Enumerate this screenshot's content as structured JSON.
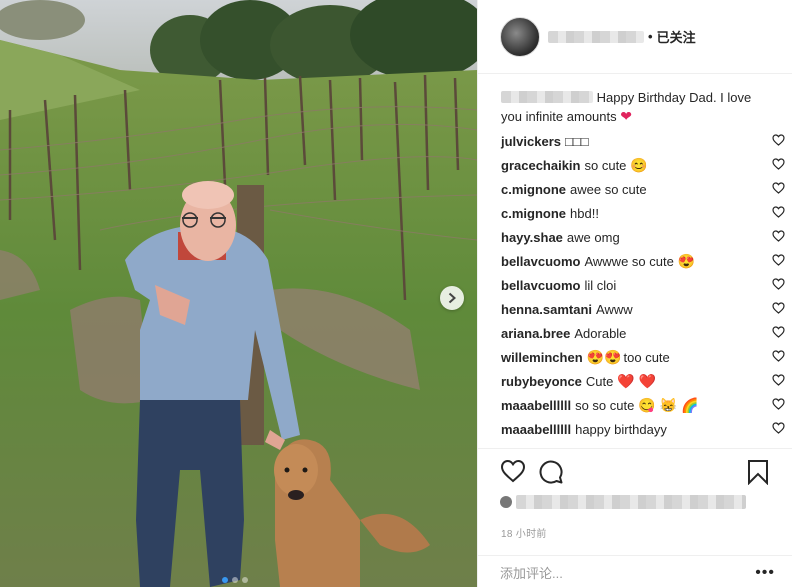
{
  "post": {
    "header": {
      "follow_label": "已关注",
      "dot": "•"
    },
    "caption": {
      "text": " Happy Birthday Dad. I love you infinite amounts "
    },
    "comments": [
      {
        "user": "julvickers",
        "text": "□□□",
        "emoji": ""
      },
      {
        "user": "gracechaikin",
        "text": "so cute",
        "emoji": "😊"
      },
      {
        "user": "c.mignone",
        "text": "awee so cute",
        "emoji": ""
      },
      {
        "user": "c.mignone",
        "text": "hbd!!",
        "emoji": ""
      },
      {
        "user": "hayy.shae",
        "text": "awe omg",
        "emoji": ""
      },
      {
        "user": "bellavcuomo",
        "text": "Awwwe so cute",
        "emoji": "😍"
      },
      {
        "user": "bellavcuomo",
        "text": "lil cloi",
        "emoji": ""
      },
      {
        "user": "henna.samtani",
        "text": "Awww",
        "emoji": ""
      },
      {
        "user": "ariana.bree",
        "text": "Adorable",
        "emoji": ""
      },
      {
        "user": "willeminchen",
        "text": "too cute",
        "emoji": "😍😍",
        "emoji_first": true
      },
      {
        "user": "rubybeyonce",
        "text": "Cute",
        "emoji": "❤️ ❤️"
      },
      {
        "user": "maaabellllll",
        "text": "so so cute",
        "emoji": "😋 😸 🌈"
      },
      {
        "user": "maaabellllll",
        "text": "happy birthdayy",
        "emoji": ""
      }
    ],
    "timestamp": "18 小时前",
    "add_comment_placeholder": "添加评论...",
    "more_label": "•••",
    "carousel": {
      "count": 3,
      "active_index": 0
    },
    "colors": {
      "accent": "#3897f0",
      "heart": "#ed4956",
      "text": "#262626",
      "muted": "#999999"
    },
    "icons": {
      "like": "heart-outline-icon",
      "comment": "speech-bubble-icon",
      "save": "bookmark-icon",
      "next": "chevron-right-icon"
    }
  }
}
